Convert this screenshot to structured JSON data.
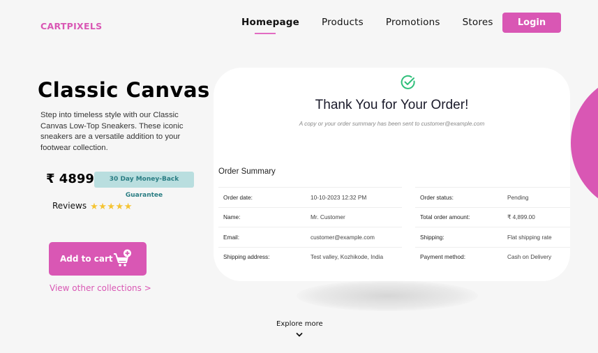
{
  "header": {
    "logo": "CARTPIXELS",
    "nav": [
      {
        "label": "Homepage",
        "active": true
      },
      {
        "label": "Products",
        "active": false
      },
      {
        "label": "Promotions",
        "active": false
      },
      {
        "label": "Stores",
        "active": false
      }
    ],
    "login_label": "Login"
  },
  "hero": {
    "title": "Classic Canvas",
    "description": "Step into timeless style with our Classic Canvas Low-Top Sneakers. These iconic sneakers are a versatile addition to your footwear collection.",
    "price": "₹ 4899",
    "guarantee_badge": "30 Day Money-Back Guarantee",
    "reviews_label": "Reviews",
    "rating": 5,
    "rating_max": 5,
    "star_glyph": "★",
    "add_to_cart_label": "Add to cart",
    "view_collections_label": "View other collections >"
  },
  "order_card": {
    "icon": "check-circle-icon",
    "title": "Thank You for Your Order!",
    "subtitle": "A copy or your order summary has been sent to customer@example.com",
    "summary_title": "Order Summary",
    "left_rows": [
      {
        "key": "Order date:",
        "value": "10-10-2023 12:32 PM"
      },
      {
        "key": "Name:",
        "value": "Mr. Customer"
      },
      {
        "key": "Email:",
        "value": "customer@example.com"
      },
      {
        "key": "Shipping address:",
        "value": "Test valley, Kozhikode, India"
      }
    ],
    "right_rows": [
      {
        "key": "Order status:",
        "value": "Pending"
      },
      {
        "key": "Total order amount:",
        "value": "₹ 4,899.00"
      },
      {
        "key": "Shipping:",
        "value": "Flat shipping rate"
      },
      {
        "key": "Payment method:",
        "value": "Cash on Delivery"
      }
    ]
  },
  "footer": {
    "explore_label": "Explore more"
  },
  "colors": {
    "brand": "#d957b4",
    "badge_bg": "#b9dedf",
    "badge_text": "#2a7d83",
    "star": "#f5c433",
    "check": "#2fbf7a",
    "background": "#f6f6f6"
  }
}
